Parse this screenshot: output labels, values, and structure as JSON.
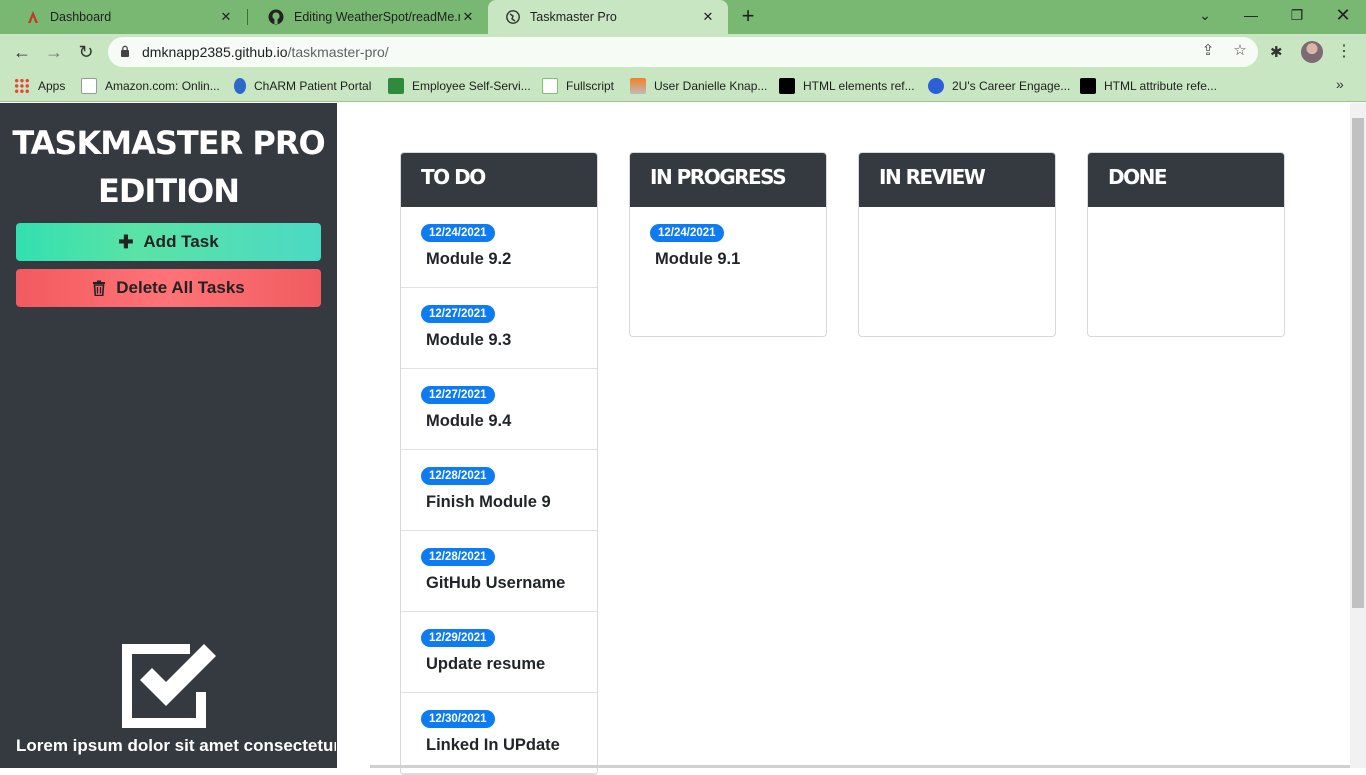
{
  "browser": {
    "tabs": [
      {
        "title": "Dashboard",
        "icon": "canvas-icon"
      },
      {
        "title": "Editing WeatherSpot/readMe.md",
        "icon": "github-icon"
      },
      {
        "title": "Taskmaster Pro",
        "icon": "globe-icon",
        "active": true
      }
    ],
    "url_domain": "dmknapp2385.github.io",
    "url_path": "/taskmaster-pro/",
    "bookmarks": [
      "Apps",
      "Amazon.com: Onlin...",
      "ChARM Patient Portal",
      "Employee Self-Servi...",
      "Fullscript",
      "User Danielle Knap...",
      "HTML elements ref...",
      "2U's Career Engage...",
      "HTML attribute refe..."
    ],
    "colors": {
      "frame": "#78b873",
      "toolbar": "#c8e6c1"
    }
  },
  "sidebar": {
    "title_line1": "TASKMASTER PRO",
    "title_line2": "EDITION",
    "add_label": "Add Task",
    "delete_label": "Delete All Tasks",
    "lorem": "Lorem ipsum dolor sit amet consectetur adipisicing elit. Modi"
  },
  "board": {
    "columns": [
      {
        "title": "TO DO",
        "cards": [
          {
            "date": "12/24/2021",
            "title": "Module 9.2"
          },
          {
            "date": "12/27/2021",
            "title": "Module 9.3"
          },
          {
            "date": "12/27/2021",
            "title": "Module 9.4"
          },
          {
            "date": "12/28/2021",
            "title": "Finish Module 9"
          },
          {
            "date": "12/28/2021",
            "title": "GitHub Username"
          },
          {
            "date": "12/29/2021",
            "title": "Update resume"
          },
          {
            "date": "12/30/2021",
            "title": "Linked In UPdate"
          }
        ]
      },
      {
        "title": "IN PROGRESS",
        "cards": [
          {
            "date": "12/24/2021",
            "title": "Module 9.1"
          }
        ]
      },
      {
        "title": "IN REVIEW",
        "cards": []
      },
      {
        "title": "DONE",
        "cards": []
      }
    ],
    "colors": {
      "header": "#343a40",
      "badge": "#0d7bf2",
      "add": "#3ee0b4",
      "delete": "#ff6b6f"
    }
  }
}
